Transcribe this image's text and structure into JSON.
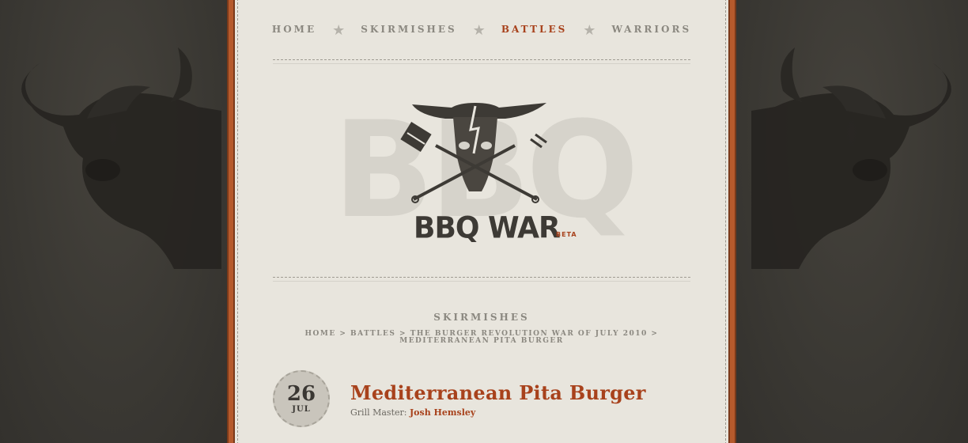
{
  "nav": {
    "items": [
      {
        "label": "HOME",
        "active": false
      },
      {
        "label": "SKIRMISHES",
        "active": false
      },
      {
        "label": "BATTLES",
        "active": true
      },
      {
        "label": "WARRIORS",
        "active": false
      }
    ],
    "separator_icon": "star-icon"
  },
  "logo": {
    "background_letters": "BBQ",
    "title": "BBQ WAR",
    "badge": "BETA",
    "emblem_icon": "bull-skull-with-crossed-spatula-and-fork-icon"
  },
  "section": {
    "title": "SKIRMISHES"
  },
  "breadcrumb": {
    "items": [
      "HOME",
      "BATTLES",
      "THE BURGER REVOLUTION WAR OF JULY 2010",
      "MEDITERRANEAN PITA BURGER"
    ],
    "separator": ">"
  },
  "post": {
    "date_day": "26",
    "date_month": "JUL",
    "title": "Mediterranean Pita Burger",
    "grill_master_label": "Grill Master:",
    "grill_master_name": "Josh Hemsley"
  },
  "colors": {
    "accent": "#a8421c",
    "paper": "#e8e5dd",
    "dark_bg": "#3a3834",
    "border_orange": "#b65a2c"
  }
}
